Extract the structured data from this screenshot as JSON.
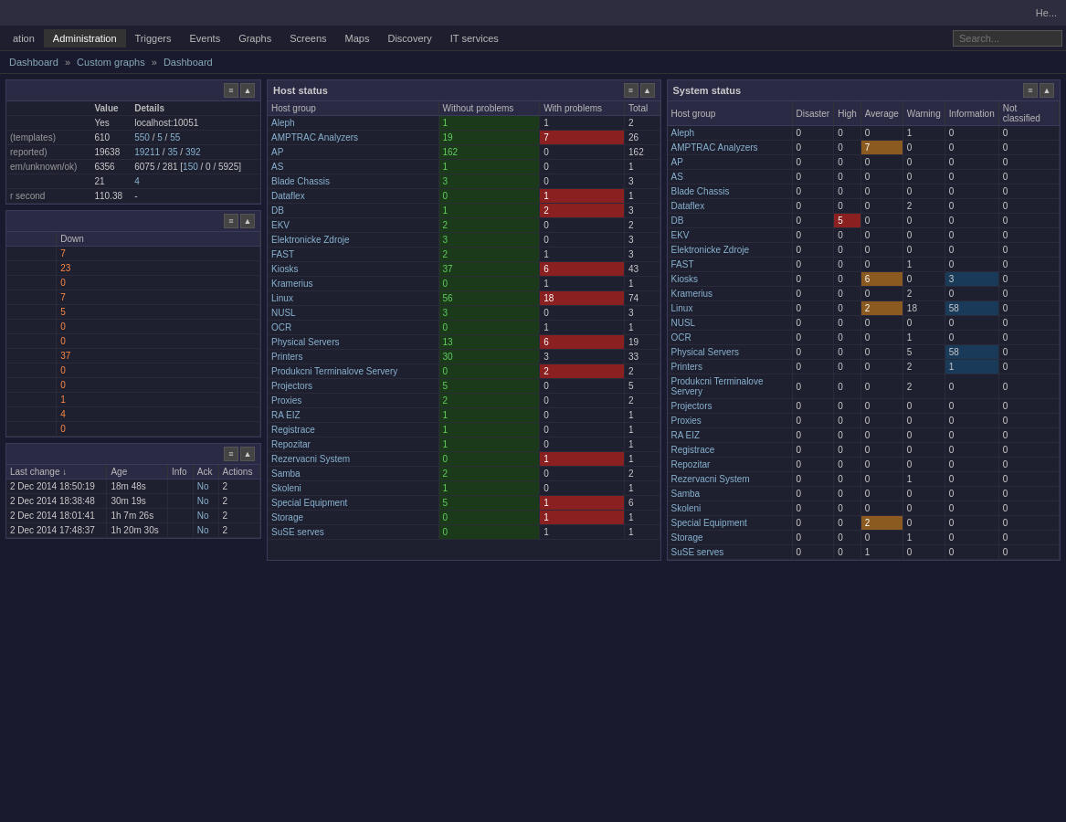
{
  "topbar": {
    "help_label": "He..."
  },
  "nav": {
    "items": [
      {
        "label": "ation",
        "active": false
      },
      {
        "label": "Administration",
        "active": true
      },
      {
        "label": "Triggers",
        "active": false
      },
      {
        "label": "Events",
        "active": false
      },
      {
        "label": "Graphs",
        "active": false
      },
      {
        "label": "Screens",
        "active": false
      },
      {
        "label": "Maps",
        "active": false
      },
      {
        "label": "Discovery",
        "active": false
      },
      {
        "label": "IT services",
        "active": false
      }
    ]
  },
  "breadcrumb": {
    "items": [
      "Dashboard",
      "Custom graphs",
      "Dashboard"
    ]
  },
  "left_widget_top": {
    "title": "",
    "rows": [
      {
        "label": "",
        "value": "Value",
        "detail": "Details"
      },
      {
        "label": "",
        "value": "Yes",
        "detail": "localhost:10051"
      },
      {
        "label": "(templates)",
        "value": "610",
        "detail": "550 / 5 / 55"
      },
      {
        "label": "reported)",
        "value": "19638",
        "detail": "19211 / 35 / 392"
      },
      {
        "label": "em/unknown/ok)",
        "value": "6356",
        "detail": "6075 / 281 [150 / 0 / 5925]"
      },
      {
        "label": "",
        "value": "21",
        "detail": "4"
      },
      {
        "label": "r second",
        "value": "110.38",
        "detail": "-"
      }
    ]
  },
  "left_widget_middle": {
    "title": "",
    "down_header": "Down",
    "rows": [
      "7",
      "23",
      "0",
      "7",
      "5",
      "0",
      "0",
      "37",
      "0",
      "0",
      "1",
      "4",
      "0"
    ]
  },
  "left_widget_bottom": {
    "title": "",
    "columns": [
      "Last change",
      "Age",
      "Info",
      "Ack",
      "Actions"
    ],
    "rows": [
      {
        "date": "2 Dec 2014 18:50:19",
        "age": "18m 48s",
        "info": "",
        "ack": "No",
        "actions": "2"
      },
      {
        "date": "2 Dec 2014 18:38:48",
        "age": "30m 19s",
        "info": "",
        "ack": "No",
        "actions": "2"
      },
      {
        "date": "2 Dec 2014 18:01:41",
        "age": "1h 7m 26s",
        "info": "",
        "ack": "No",
        "actions": "2"
      },
      {
        "date": "2 Dec 2014 17:48:37",
        "age": "1h 20m 30s",
        "info": "",
        "ack": "No",
        "actions": "2"
      }
    ]
  },
  "host_status": {
    "title": "Host status",
    "columns": [
      "Host group",
      "Without problems",
      "With problems",
      "Total"
    ],
    "rows": [
      {
        "group": "Aleph",
        "without": "1",
        "with": "1",
        "total": "2",
        "with_color": "normal"
      },
      {
        "group": "AMPTRAC Analyzers",
        "without": "19",
        "with": "7",
        "total": "26",
        "with_color": "red"
      },
      {
        "group": "AP",
        "without": "162",
        "with": "0",
        "total": "162",
        "with_color": "normal"
      },
      {
        "group": "AS",
        "without": "1",
        "with": "0",
        "total": "1",
        "with_color": "normal"
      },
      {
        "group": "Blade Chassis",
        "without": "3",
        "with": "0",
        "total": "3",
        "with_color": "normal"
      },
      {
        "group": "Dataflex",
        "without": "0",
        "with": "1",
        "total": "1",
        "with_color": "red"
      },
      {
        "group": "DB",
        "without": "1",
        "with": "2",
        "total": "3",
        "with_color": "red"
      },
      {
        "group": "EKV",
        "without": "2",
        "with": "0",
        "total": "2",
        "with_color": "normal"
      },
      {
        "group": "Elektronicke Zdroje",
        "without": "3",
        "with": "0",
        "total": "3",
        "with_color": "normal"
      },
      {
        "group": "FAST",
        "without": "2",
        "with": "1",
        "total": "3",
        "with_color": "normal"
      },
      {
        "group": "Kiosks",
        "without": "37",
        "with": "6",
        "total": "43",
        "with_color": "red"
      },
      {
        "group": "Kramerius",
        "without": "0",
        "with": "1",
        "total": "1",
        "with_color": "normal"
      },
      {
        "group": "Linux",
        "without": "56",
        "with": "18",
        "total": "74",
        "with_color": "red"
      },
      {
        "group": "NUSL",
        "without": "3",
        "with": "0",
        "total": "3",
        "with_color": "normal"
      },
      {
        "group": "OCR",
        "without": "0",
        "with": "1",
        "total": "1",
        "with_color": "normal"
      },
      {
        "group": "Physical Servers",
        "without": "13",
        "with": "6",
        "total": "19",
        "with_color": "red"
      },
      {
        "group": "Printers",
        "without": "30",
        "with": "3",
        "total": "33",
        "with_color": "normal"
      },
      {
        "group": "Produkcni Terminalove Servery",
        "without": "0",
        "with": "2",
        "total": "2",
        "with_color": "red"
      },
      {
        "group": "Projectors",
        "without": "5",
        "with": "0",
        "total": "5",
        "with_color": "normal"
      },
      {
        "group": "Proxies",
        "without": "2",
        "with": "0",
        "total": "2",
        "with_color": "normal"
      },
      {
        "group": "RA EIZ",
        "without": "1",
        "with": "0",
        "total": "1",
        "with_color": "normal"
      },
      {
        "group": "Registrace",
        "without": "1",
        "with": "0",
        "total": "1",
        "with_color": "normal"
      },
      {
        "group": "Repozitar",
        "without": "1",
        "with": "0",
        "total": "1",
        "with_color": "normal"
      },
      {
        "group": "Rezervacni System",
        "without": "0",
        "with": "1",
        "total": "1",
        "with_color": "red"
      },
      {
        "group": "Samba",
        "without": "2",
        "with": "0",
        "total": "2",
        "with_color": "normal"
      },
      {
        "group": "Skoleni",
        "without": "1",
        "with": "0",
        "total": "1",
        "with_color": "normal"
      },
      {
        "group": "Special Equipment",
        "without": "5",
        "with": "1",
        "total": "6",
        "with_color": "red"
      },
      {
        "group": "Storage",
        "without": "0",
        "with": "1",
        "total": "1",
        "with_color": "red"
      },
      {
        "group": "SuSE serves",
        "without": "0",
        "with": "1",
        "total": "1",
        "with_color": "normal"
      }
    ]
  },
  "system_status": {
    "title": "System status",
    "columns": [
      "Host group",
      "Disaster",
      "High",
      "Average",
      "Warning",
      "Information",
      "Not classified"
    ],
    "rows": [
      {
        "group": "Aleph",
        "disaster": "0",
        "high": "0",
        "average": "0",
        "warning": "1",
        "information": "0",
        "not_classified": "0",
        "avg_color": "normal",
        "warn_color": "normal"
      },
      {
        "group": "AMPTRAC Analyzers",
        "disaster": "0",
        "high": "0",
        "average": "7",
        "warning": "0",
        "information": "0",
        "not_classified": "0",
        "avg_color": "orange",
        "warn_color": "normal"
      },
      {
        "group": "AP",
        "disaster": "0",
        "high": "0",
        "average": "0",
        "warning": "0",
        "information": "0",
        "not_classified": "0",
        "avg_color": "normal",
        "warn_color": "normal"
      },
      {
        "group": "AS",
        "disaster": "0",
        "high": "0",
        "average": "0",
        "warning": "0",
        "information": "0",
        "not_classified": "0",
        "avg_color": "normal",
        "warn_color": "normal"
      },
      {
        "group": "Blade Chassis",
        "disaster": "0",
        "high": "0",
        "average": "0",
        "warning": "0",
        "information": "0",
        "not_classified": "0",
        "avg_color": "normal",
        "warn_color": "normal"
      },
      {
        "group": "Dataflex",
        "disaster": "0",
        "high": "0",
        "average": "0",
        "warning": "2",
        "information": "0",
        "not_classified": "0",
        "avg_color": "normal",
        "warn_color": "normal"
      },
      {
        "group": "DB",
        "disaster": "0",
        "high": "5",
        "average": "0",
        "warning": "0",
        "information": "0",
        "not_classified": "0",
        "avg_color": "normal",
        "warn_color": "normal",
        "high_color": "red"
      },
      {
        "group": "EKV",
        "disaster": "0",
        "high": "0",
        "average": "0",
        "warning": "0",
        "information": "0",
        "not_classified": "0",
        "avg_color": "normal",
        "warn_color": "normal"
      },
      {
        "group": "Elektronicke Zdroje",
        "disaster": "0",
        "high": "0",
        "average": "0",
        "warning": "0",
        "information": "0",
        "not_classified": "0",
        "avg_color": "normal",
        "warn_color": "normal"
      },
      {
        "group": "FAST",
        "disaster": "0",
        "high": "0",
        "average": "0",
        "warning": "1",
        "information": "0",
        "not_classified": "0",
        "avg_color": "normal",
        "warn_color": "normal"
      },
      {
        "group": "Kiosks",
        "disaster": "0",
        "high": "0",
        "average": "6",
        "warning": "0",
        "information": "3",
        "not_classified": "0",
        "avg_color": "orange",
        "warn_color": "normal",
        "info_color": "blue"
      },
      {
        "group": "Kramerius",
        "disaster": "0",
        "high": "0",
        "average": "0",
        "warning": "2",
        "information": "0",
        "not_classified": "0",
        "avg_color": "normal",
        "warn_color": "normal"
      },
      {
        "group": "Linux",
        "disaster": "0",
        "high": "0",
        "average": "2",
        "warning": "18",
        "information": "58",
        "not_classified": "0",
        "avg_color": "orange",
        "warn_color": "normal",
        "info_color": "blue"
      },
      {
        "group": "NUSL",
        "disaster": "0",
        "high": "0",
        "average": "0",
        "warning": "0",
        "information": "0",
        "not_classified": "0",
        "avg_color": "normal",
        "warn_color": "normal"
      },
      {
        "group": "OCR",
        "disaster": "0",
        "high": "0",
        "average": "0",
        "warning": "1",
        "information": "0",
        "not_classified": "0",
        "avg_color": "normal",
        "warn_color": "normal"
      },
      {
        "group": "Physical Servers",
        "disaster": "0",
        "high": "0",
        "average": "0",
        "warning": "5",
        "information": "58",
        "not_classified": "0",
        "avg_color": "normal",
        "warn_color": "normal",
        "info_color": "blue"
      },
      {
        "group": "Printers",
        "disaster": "0",
        "high": "0",
        "average": "0",
        "warning": "2",
        "information": "1",
        "not_classified": "0",
        "avg_color": "normal",
        "warn_color": "normal",
        "info_color": "blue"
      },
      {
        "group": "Produkcni Terminalove Servery",
        "disaster": "0",
        "high": "0",
        "average": "0",
        "warning": "2",
        "information": "0",
        "not_classified": "0",
        "avg_color": "normal",
        "warn_color": "normal"
      },
      {
        "group": "Projectors",
        "disaster": "0",
        "high": "0",
        "average": "0",
        "warning": "0",
        "information": "0",
        "not_classified": "0",
        "avg_color": "normal",
        "warn_color": "normal"
      },
      {
        "group": "Proxies",
        "disaster": "0",
        "high": "0",
        "average": "0",
        "warning": "0",
        "information": "0",
        "not_classified": "0",
        "avg_color": "normal",
        "warn_color": "normal"
      },
      {
        "group": "RA EIZ",
        "disaster": "0",
        "high": "0",
        "average": "0",
        "warning": "0",
        "information": "0",
        "not_classified": "0",
        "avg_color": "normal",
        "warn_color": "normal"
      },
      {
        "group": "Registrace",
        "disaster": "0",
        "high": "0",
        "average": "0",
        "warning": "0",
        "information": "0",
        "not_classified": "0",
        "avg_color": "normal",
        "warn_color": "normal"
      },
      {
        "group": "Repozitar",
        "disaster": "0",
        "high": "0",
        "average": "0",
        "warning": "0",
        "information": "0",
        "not_classified": "0",
        "avg_color": "normal",
        "warn_color": "normal"
      },
      {
        "group": "Rezervacni System",
        "disaster": "0",
        "high": "0",
        "average": "0",
        "warning": "1",
        "information": "0",
        "not_classified": "0",
        "avg_color": "normal",
        "warn_color": "normal"
      },
      {
        "group": "Samba",
        "disaster": "0",
        "high": "0",
        "average": "0",
        "warning": "0",
        "information": "0",
        "not_classified": "0",
        "avg_color": "normal",
        "warn_color": "normal"
      },
      {
        "group": "Skoleni",
        "disaster": "0",
        "high": "0",
        "average": "0",
        "warning": "0",
        "information": "0",
        "not_classified": "0",
        "avg_color": "normal",
        "warn_color": "normal"
      },
      {
        "group": "Special Equipment",
        "disaster": "0",
        "high": "0",
        "average": "2",
        "warning": "0",
        "information": "0",
        "not_classified": "0",
        "avg_color": "orange",
        "warn_color": "normal"
      },
      {
        "group": "Storage",
        "disaster": "0",
        "high": "0",
        "average": "0",
        "warning": "1",
        "information": "0",
        "not_classified": "0",
        "avg_color": "normal",
        "warn_color": "normal"
      },
      {
        "group": "SuSE serves",
        "disaster": "0",
        "high": "0",
        "average": "1",
        "warning": "0",
        "information": "0",
        "not_classified": "0",
        "avg_color": "normal",
        "warn_color": "normal"
      }
    ]
  }
}
